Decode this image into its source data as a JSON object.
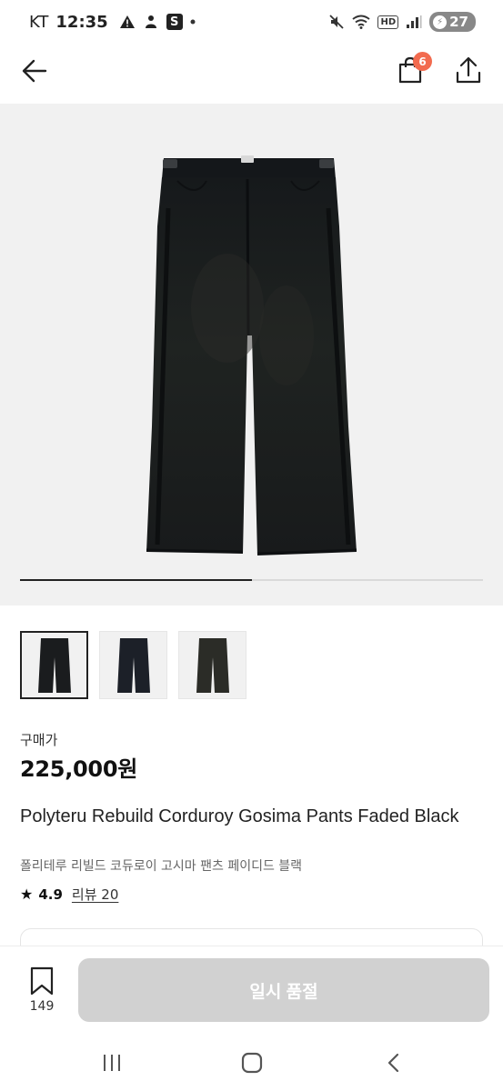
{
  "status_bar": {
    "carrier": "KT",
    "time": "12:35",
    "battery": "27"
  },
  "header": {
    "cart_count": "6"
  },
  "gallery": {
    "progress": 0.5,
    "thumbnails": [
      {
        "name": "thumb-1",
        "color": "#1a1c1e"
      },
      {
        "name": "thumb-2",
        "color": "#1c2028"
      },
      {
        "name": "thumb-3",
        "color": "#2b2c27"
      }
    ]
  },
  "product": {
    "price_label": "구매가",
    "price": "225,000원",
    "title_en": "Polyteru Rebuild Corduroy Gosima Pants Faded Black",
    "title_ko": "폴리테루 리빌드 코듀로이 고시마 팬츠 페이디드 블랙",
    "rating": "4.9",
    "review_label": "리뷰 20"
  },
  "action_bar": {
    "bookmark_count": "149",
    "button_label": "일시 품절"
  },
  "colors": {
    "accent_badge": "#f26b4f",
    "disabled_button": "#d1d1d1"
  }
}
